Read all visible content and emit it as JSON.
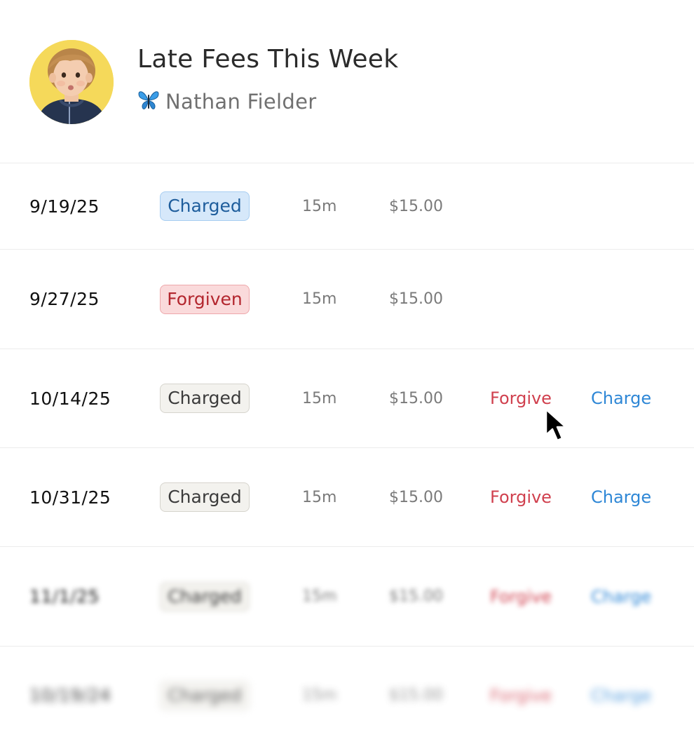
{
  "header": {
    "title": "Late Fees This Week",
    "user_name": "Nathan Fielder",
    "user_icon": "butterfly-icon",
    "avatar": "child-portrait"
  },
  "colors": {
    "forgive_action": "#d0404e",
    "charge_action": "#2e87d6",
    "charged_badge_blue": "#1e5d9c",
    "forgiven_badge": "#b3262e"
  },
  "rows": [
    {
      "date": "9/19/25",
      "status": "Charged",
      "duration": "15m",
      "amount": "$15.00",
      "forgive": "",
      "charge": ""
    },
    {
      "date": "9/27/25",
      "status": "Forgiven",
      "duration": "15m",
      "amount": "$15.00",
      "forgive": "",
      "charge": ""
    },
    {
      "date": "10/14/25",
      "status": "Charged",
      "duration": "15m",
      "amount": "$15.00",
      "forgive": "Forgive",
      "charge": "Charge"
    },
    {
      "date": "10/31/25",
      "status": "Charged",
      "duration": "15m",
      "amount": "$15.00",
      "forgive": "Forgive",
      "charge": "Charge"
    },
    {
      "date": "11/1/25",
      "status": "Charged",
      "duration": "15m",
      "amount": "$15.00",
      "forgive": "Forgive",
      "charge": "Charge"
    },
    {
      "date": "10/19/24",
      "status": "Charged",
      "duration": "15m",
      "amount": "$15.00",
      "forgive": "Forgive",
      "charge": "Charge"
    }
  ]
}
